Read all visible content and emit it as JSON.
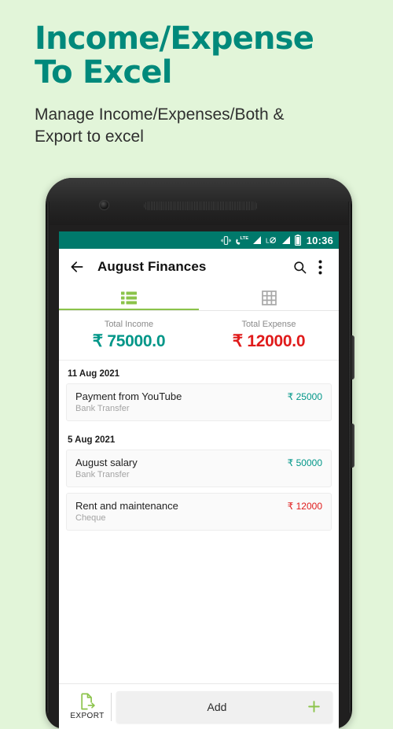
{
  "promo": {
    "title": "Income/Expense\nTo Excel",
    "subtitle": "Manage Income/Expenses/Both &\nExport to excel",
    "title_color": "#00897b",
    "background_color": "#e2f5d9"
  },
  "statusbar": {
    "time": "10:36",
    "icons": [
      "vibrate-icon",
      "lte-signal-icon",
      "signal-bars-icon",
      "roaming-icon",
      "signal-bars-icon",
      "battery-icon"
    ],
    "background_color": "#00796b"
  },
  "appbar": {
    "back_icon": "back-arrow-icon",
    "title": "August Finances",
    "search_icon": "search-icon",
    "overflow_icon": "more-vertical-icon"
  },
  "tabs": [
    {
      "id": "list",
      "icon": "list-view-icon",
      "active": true,
      "color": "#8bc34a"
    },
    {
      "id": "grid",
      "icon": "grid-view-icon",
      "active": false,
      "color": "#9e9e9e"
    }
  ],
  "totals": {
    "income": {
      "label": "Total Income",
      "value": "₹ 75000.0",
      "color": "#009688"
    },
    "expense": {
      "label": "Total Expense",
      "value": "₹ 12000.0",
      "color": "#e01b1b"
    }
  },
  "groups": [
    {
      "date": "11 Aug 2021",
      "transactions": [
        {
          "title": "Payment from YouTube",
          "method": "Bank Transfer",
          "amount": "₹ 25000",
          "type": "income"
        }
      ]
    },
    {
      "date": "5 Aug 2021",
      "transactions": [
        {
          "title": "August salary",
          "method": "Bank Transfer",
          "amount": "₹ 50000",
          "type": "income"
        },
        {
          "title": "Rent and maintenance",
          "method": "Cheque",
          "amount": "₹ 12000",
          "type": "expense"
        }
      ]
    }
  ],
  "bottombar": {
    "export_icon": "export-file-icon",
    "export_label": "EXPORT",
    "add_label": "Add",
    "add_icon": "plus-icon",
    "accent_color": "#8bc34a"
  }
}
